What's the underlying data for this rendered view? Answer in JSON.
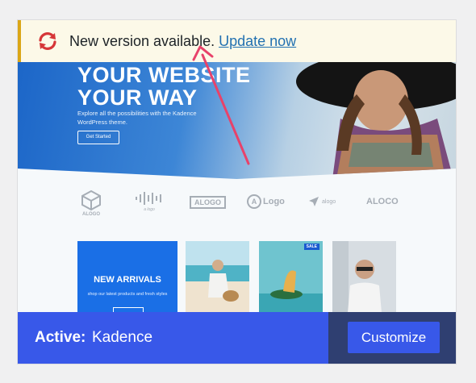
{
  "notice": {
    "message": "New version available.",
    "link": "Update now"
  },
  "screenshot": {
    "hero_title_line1": "YOUR WEBSITE",
    "hero_title_line2": "YOUR WAY",
    "hero_subtitle": "Explore all the possibilities with the Kadence WordPress theme.",
    "hero_button": "Get Started",
    "logos": [
      "ALOGO",
      "a logo",
      "ALOGO",
      "Logo",
      "alogo",
      "ALOCO"
    ],
    "promo_title": "NEW ARRIVALS",
    "promo_subtitle": "shop our latest products and fresh styles",
    "sale_badge": "SALE"
  },
  "footer": {
    "active_label": "Active:",
    "theme_name": "Kadence",
    "customize_label": "Customize"
  },
  "colors": {
    "notice_bg": "#fcf9e8",
    "notice_border": "#dba617",
    "link": "#2271b1",
    "update_icon": "#d63638",
    "footer_bg": "#3858e9",
    "footer_dark": "#2f3f71",
    "arrow": "#e8426a"
  }
}
